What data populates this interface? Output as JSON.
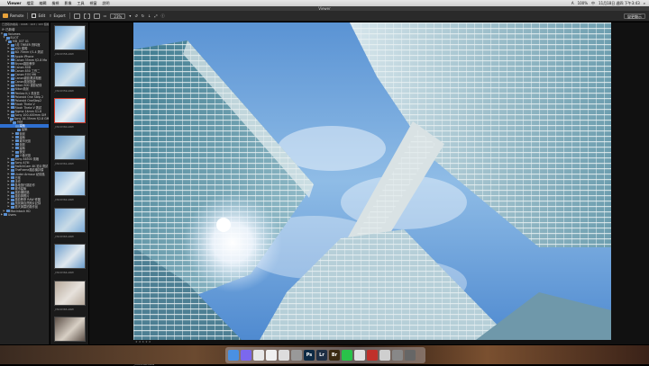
{
  "menubar": {
    "app_name": "Viewer",
    "menus": [
      "檔案",
      "編輯",
      "檢視",
      "影像",
      "工具",
      "視窗",
      "說明"
    ],
    "right_status": [
      "A",
      "100%",
      "中",
      "Q"
    ],
    "clock": "11月18日 週四 下午3:43"
  },
  "window": {
    "title": "Viewer"
  },
  "toolbar": {
    "remote_label": "Remote",
    "edit_label": "Edit",
    "export_label": "Export",
    "zoom_level": "23%",
    "view_mode": "變更顯示"
  },
  "sidebar": {
    "path": "已選取的檔案 : 0008 : 103 / 103 個檔案",
    "header": "已新增",
    "items": [
      {
        "label": "Volumes",
        "level": 0,
        "tri": "▼"
      },
      {
        "label": "ELIOT",
        "level": 1,
        "tri": "▼"
      },
      {
        "label": "MD_01T 01",
        "level": 2,
        "tri": "▼"
      },
      {
        "label": "5月 TMBER 資料館",
        "level": 3,
        "tri": "▶"
      },
      {
        "label": "5D5 模擬",
        "level": 3,
        "tri": "▶"
      },
      {
        "label": "6D 75mm f/1.4 測試",
        "level": 3,
        "tri": "▶"
      },
      {
        "label": "Apple iPhone",
        "level": 3,
        "tri": "▶"
      },
      {
        "label": "Canon 35mm f/2.8 Ma",
        "level": 3,
        "tri": "▶"
      },
      {
        "label": "Bryan攝影教學",
        "level": 3,
        "tri": "▶"
      },
      {
        "label": "Canon 80D",
        "level": 3,
        "tri": "▶"
      },
      {
        "label": "Canon 850 工作二",
        "level": 3,
        "tri": "▶"
      },
      {
        "label": "Canon EOS M6",
        "level": 3,
        "tri": "▶"
      },
      {
        "label": "Canon攝影測試相館",
        "level": 3,
        "tri": "▶"
      },
      {
        "label": "Canon風景旅遊",
        "level": 3,
        "tri": "▶"
      },
      {
        "label": "Nikon 500 攝影紀錄",
        "level": 3,
        "tri": "▶"
      },
      {
        "label": "Nikon風景",
        "level": 3,
        "tri": "▶"
      },
      {
        "label": "Pentax K-1 風景區",
        "level": 3,
        "tri": "▶"
      },
      {
        "label": "Polaroid One Step 2",
        "level": 3,
        "tri": "▶"
      },
      {
        "label": "Polaroid OneStep2",
        "level": 3,
        "tri": "▶"
      },
      {
        "label": "Ricoh Theta V",
        "level": 3,
        "tri": "▶"
      },
      {
        "label": "Ricoh Theta V 測試",
        "level": 3,
        "tri": "▶"
      },
      {
        "label": "Sigma 14mm f/1.8",
        "level": 3,
        "tri": "▶"
      },
      {
        "label": "Sony 100-400mm GM",
        "level": 3,
        "tri": "▶"
      },
      {
        "label": "Sony 16-35mm f/2.8 GM",
        "level": 3,
        "tri": "▼"
      },
      {
        "label": "外拍",
        "level": 4,
        "tri": "▼"
      },
      {
        "label": "建築",
        "level": 5,
        "tri": "",
        "sel": true
      },
      {
        "label": "建築",
        "level": 6,
        "tri": ""
      },
      {
        "label": "街景",
        "level": 5,
        "tri": "▶"
      },
      {
        "label": "建築",
        "level": 5,
        "tri": "▶"
      },
      {
        "label": "城市光影",
        "level": 5,
        "tri": "▶"
      },
      {
        "label": "景觀",
        "level": 5,
        "tri": "▶"
      },
      {
        "label": "建築",
        "level": 5,
        "tri": "▶"
      },
      {
        "label": "夜景",
        "level": 5,
        "tri": "▶"
      },
      {
        "label": "人像光影",
        "level": 5,
        "tri": "▶"
      },
      {
        "label": "Sony A6500 風格",
        "level": 3,
        "tri": "▶"
      },
      {
        "label": "Sony A7III",
        "level": 3,
        "tri": "▶"
      },
      {
        "label": "SwitchCam 4K 影片測試",
        "level": 3,
        "tri": "▶"
      },
      {
        "label": "TheFrame攝影機評價",
        "level": 3,
        "tri": "▶"
      },
      {
        "label": "Under Armour 紀錄攝",
        "level": 3,
        "tri": "▶"
      },
      {
        "label": "日常",
        "level": 3,
        "tri": "▶"
      },
      {
        "label": "手作",
        "level": 3,
        "tri": "▶"
      },
      {
        "label": "各地旅行攝影作",
        "level": 3,
        "tri": "▶"
      },
      {
        "label": "城市建築",
        "level": 3,
        "tri": "▶"
      },
      {
        "label": "攝影棚拍攝",
        "level": 3,
        "tri": "▶"
      },
      {
        "label": "攝影師照片",
        "level": 3,
        "tri": "▶"
      },
      {
        "label": "攝影教學 RAW 修圖",
        "level": 3,
        "tri": "▶"
      },
      {
        "label": "風景與自然照片記錄",
        "level": 3,
        "tri": "▶"
      },
      {
        "label": "藍天與雲拍攝作品",
        "level": 3,
        "tri": "▶"
      },
      {
        "label": "Macintosh HD",
        "level": 1,
        "tri": "▶"
      },
      {
        "label": "Users",
        "level": 0,
        "tri": "▶"
      }
    ]
  },
  "thumbnails": [
    {
      "label": "_DSC0358.ARW"
    },
    {
      "label": "_DSC0359.ARW"
    },
    {
      "label": "_DSC0360.ARW",
      "sel": true
    },
    {
      "label": "_DSC0361.ARW"
    },
    {
      "label": "_DSC0362.ARW"
    },
    {
      "label": "_DSC0363.ARW"
    },
    {
      "label": "_DSC0364.ARW"
    },
    {
      "label": "_DSC0365.ARW"
    },
    {
      "label": "_DSC0366.ARW"
    }
  ],
  "viewer": {
    "caption": "_DSC0360.ARW",
    "rating": "★★★★★"
  },
  "dock": [
    {
      "label": "",
      "color": "#4a90e2",
      "icon": "finder-icon"
    },
    {
      "label": "",
      "color": "#7b68ee",
      "icon": "launchpad-icon"
    },
    {
      "label": "",
      "color": "#e8e8e8",
      "icon": "chrome-icon"
    },
    {
      "label": "",
      "color": "#f0f0f0",
      "icon": "notes-icon"
    },
    {
      "label": "",
      "color": "#ddd",
      "icon": "document-icon"
    },
    {
      "label": "",
      "color": "#999",
      "icon": "system-preferences-icon"
    },
    {
      "label": "Ps",
      "color": "#0e2a44",
      "icon": "photoshop-icon"
    },
    {
      "label": "Lr",
      "color": "#1f2f44",
      "icon": "lightroom-icon"
    },
    {
      "label": "Br",
      "color": "#3a2a12",
      "icon": "bridge-icon"
    },
    {
      "label": "",
      "color": "#2ac24a",
      "icon": "line-icon"
    },
    {
      "label": "",
      "color": "#e0e0e0",
      "icon": "calendar-icon"
    },
    {
      "label": "",
      "color": "#c0302a",
      "icon": "viewer-icon"
    },
    {
      "label": "",
      "color": "#cfcfcf",
      "icon": "preview-icon"
    },
    {
      "label": "",
      "color": "#888",
      "icon": "folder-icon"
    },
    {
      "label": "",
      "color": "#666",
      "icon": "trash-icon"
    }
  ],
  "colors": {
    "selection": "#2f6fd0",
    "thumb_selected_border": "#d23a2a",
    "folder": "#5a8fd0"
  }
}
